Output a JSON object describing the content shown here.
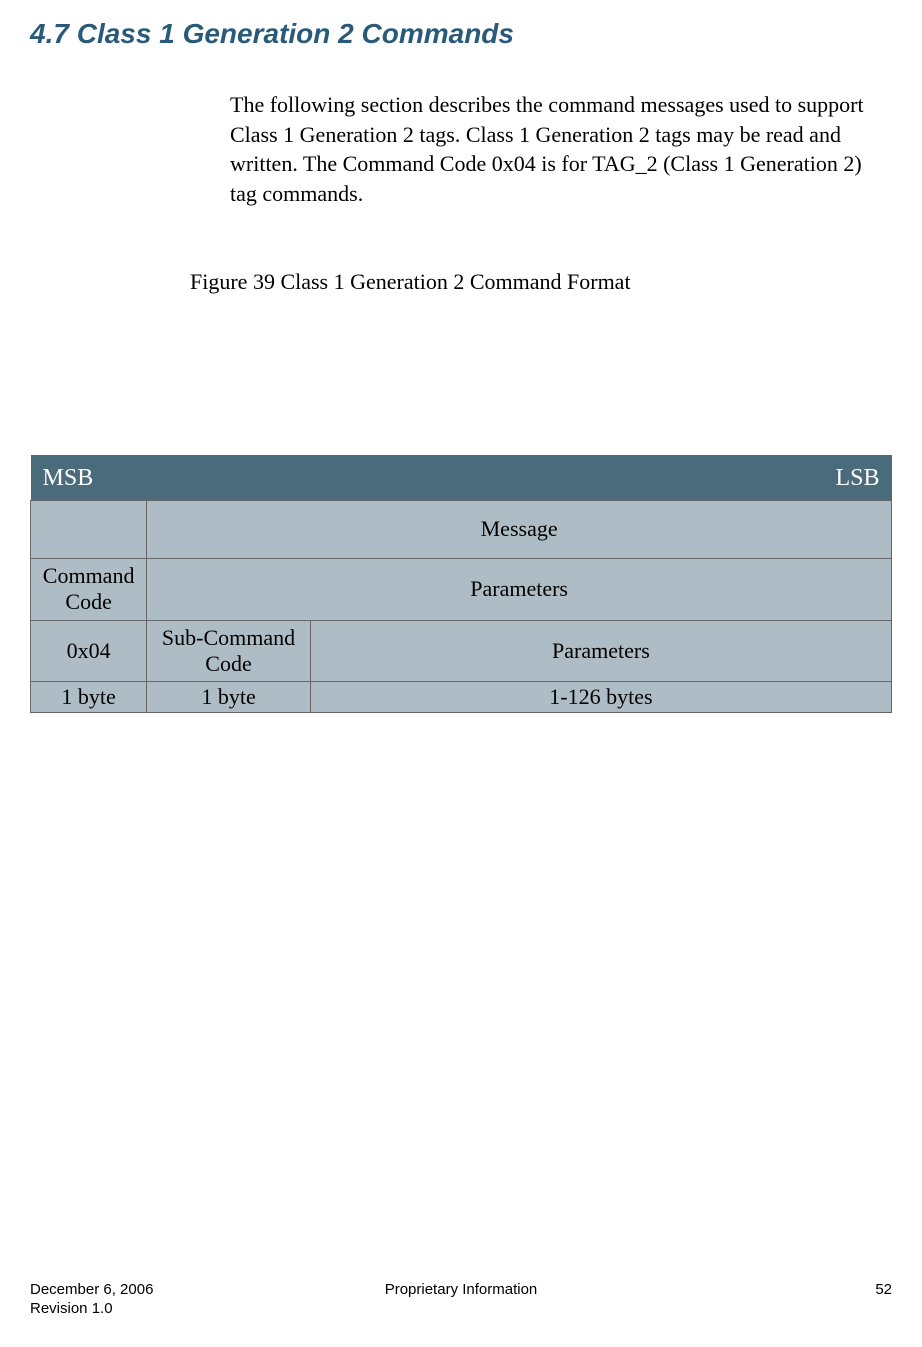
{
  "section": {
    "number": "4.7",
    "title": "Class 1 Generation 2 Commands"
  },
  "intro": "The following section describes the command messages used to support Class 1 Generation 2 tags.  Class 1 Generation 2 tags may be read and written.  The Command Code 0x04 is for TAG_2  (Class 1 Generation 2) tag commands.",
  "figure_caption": "Figure 39 Class 1 Generation 2 Command Format",
  "table": {
    "header_left": "MSB",
    "header_right": "LSB",
    "row_message": "Message",
    "command_code_label": "Command Code",
    "parameters_label": "Parameters",
    "value_0x04": "0x04",
    "sub_command_code_label": "Sub-Command Code",
    "parameters2_label": "Parameters",
    "size_col1": "1 byte",
    "size_col2": "1 byte",
    "size_col3": "1-126 bytes"
  },
  "footer": {
    "date": "December 6, 2006",
    "center": "Proprietary Information",
    "page": "52",
    "revision": "Revision 1.0"
  }
}
